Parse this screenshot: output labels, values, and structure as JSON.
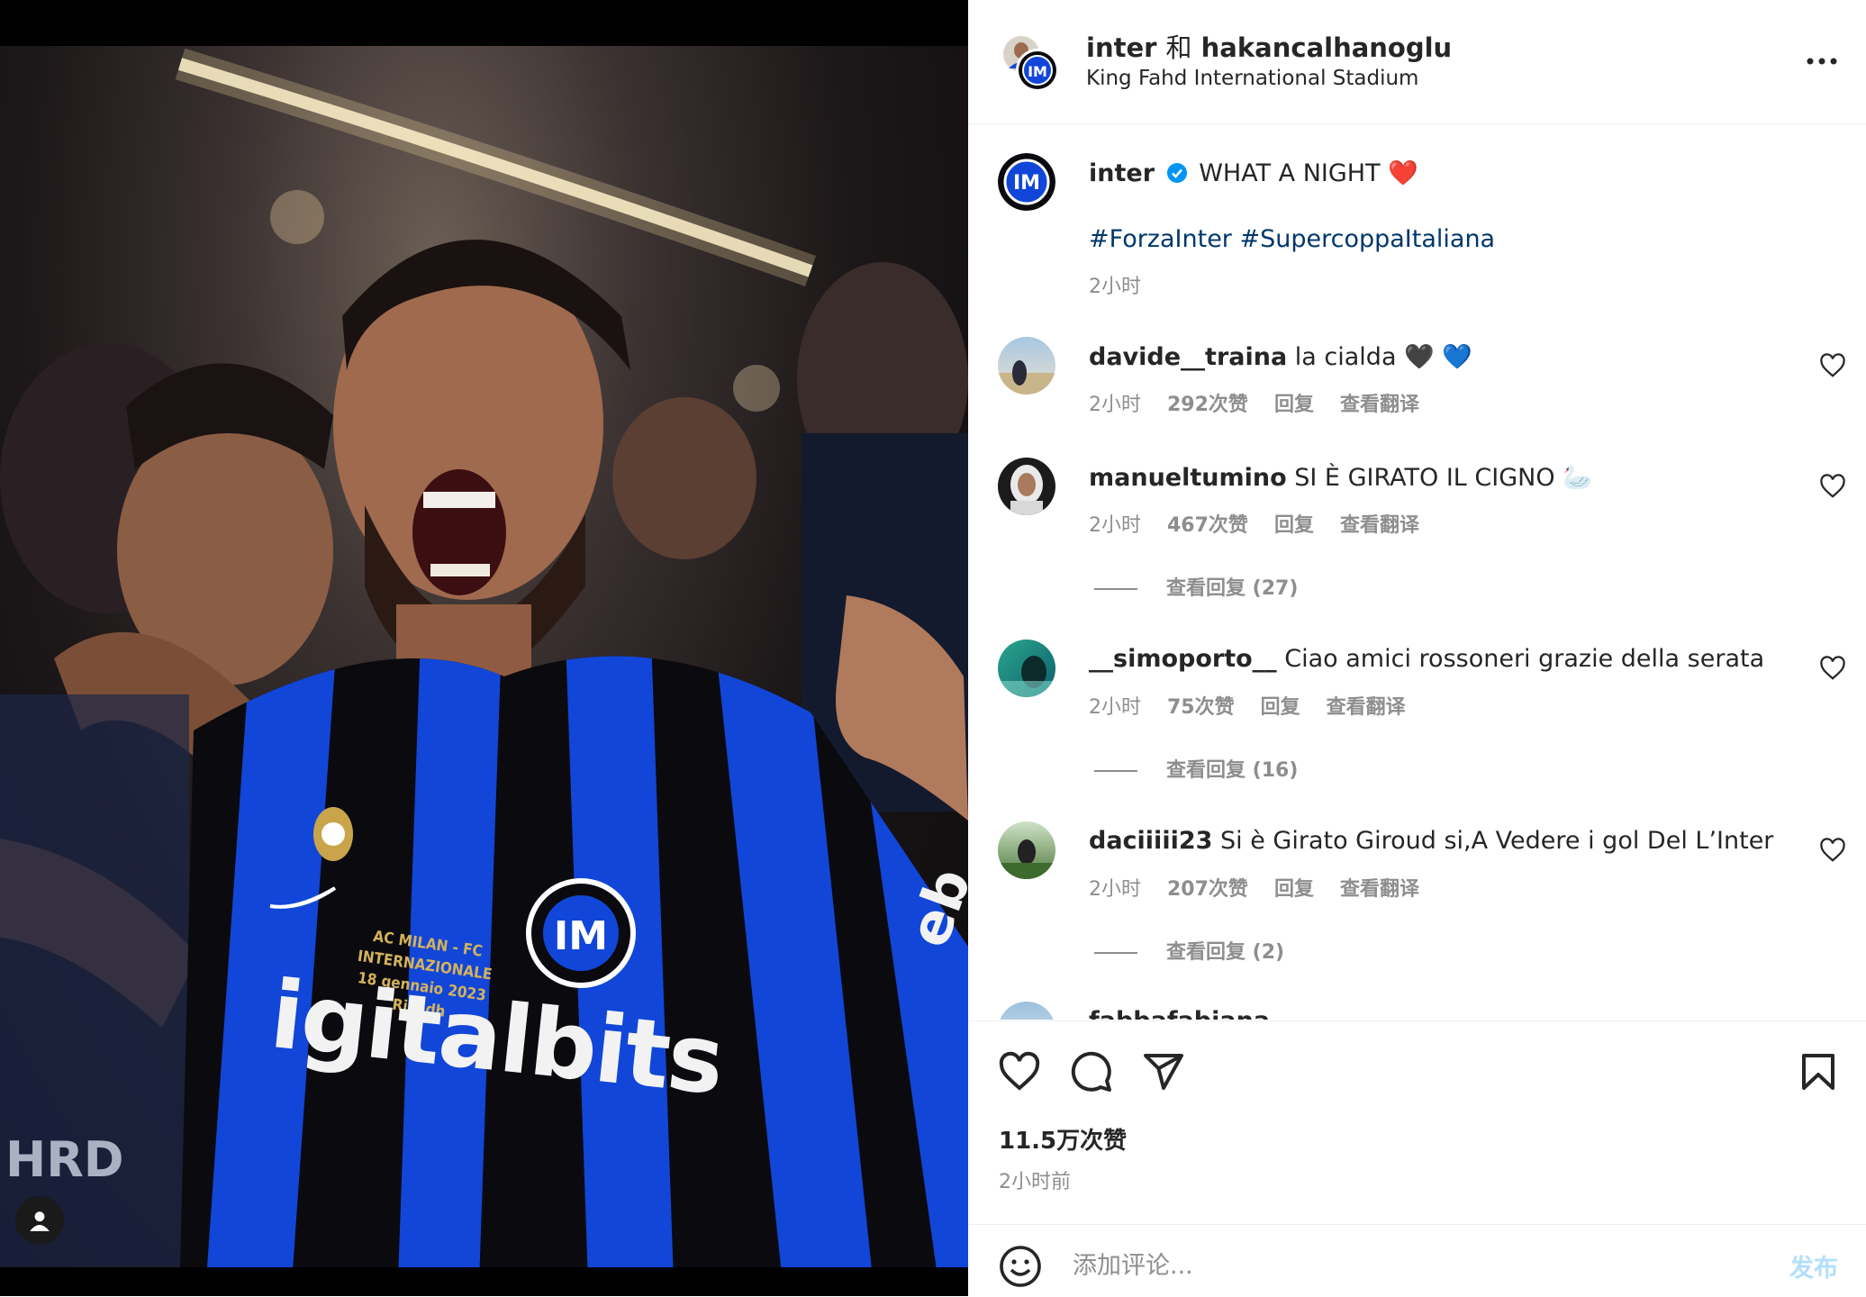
{
  "header": {
    "account_primary": "inter",
    "conjunction": "和",
    "account_secondary": "hakancalhanoglu",
    "location": "King Fahd International Stadium",
    "more_icon": "more-horizontal-icon"
  },
  "caption": {
    "username": "inter",
    "verified": true,
    "text": "WHAT A NIGHT",
    "emoji": "❤️",
    "hashtags": "#ForzaInter #SupercoppaItaliana",
    "time": "2小时"
  },
  "comments": [
    {
      "username": "davide__traina",
      "text": "la cialda",
      "emoji": "🖤 💙",
      "time": "2小时",
      "likes": "292次赞",
      "reply": "回复",
      "translate": "查看翻译"
    },
    {
      "username": "manueltumino",
      "text": "SI È GIRATO IL CIGNO",
      "emoji": "🦢",
      "time": "2小时",
      "likes": "467次赞",
      "reply": "回复",
      "translate": "查看翻译",
      "view_replies": "查看回复 (27)"
    },
    {
      "username": "__simoporto__",
      "text": "Ciao amici rossoneri grazie della serata",
      "emoji": "",
      "time": "2小时",
      "likes": "75次赞",
      "reply": "回复",
      "translate": "查看翻译",
      "view_replies": "查看回复 (16)"
    },
    {
      "username": "daciiiii23",
      "text": "Si è Girato Giroud si,A Vedere i gol Del L’Inter",
      "emoji": "",
      "time": "2小时",
      "likes": "207次赞",
      "reply": "回复",
      "translate": "查看翻译",
      "view_replies": "查看回复 (2)"
    },
    {
      "username": "fabbafabiana",
      "text": "",
      "emoji": "",
      "time": "",
      "likes": "",
      "reply": "",
      "translate": ""
    }
  ],
  "actions": {
    "like_icon": "heart-icon",
    "comment_icon": "comment-icon",
    "share_icon": "send-icon",
    "save_icon": "bookmark-icon",
    "likes": "11.5万次赞",
    "posted": "2小时前"
  },
  "add_comment": {
    "placeholder": "添加评论...",
    "post_label": "发布",
    "emoji_icon": "smiley-icon"
  },
  "photo": {
    "jersey_text": "igitalbits",
    "jersey_patch_lines": [
      "AC MILAN - FC INTERNAZIONALE",
      "18 gennaio 2023",
      "Riyadh"
    ],
    "sleeve_text": "eb",
    "back_text": "HRD",
    "user_tag_icon": "user-tag-icon"
  },
  "colors": {
    "inter_blue": "#0b4fd6",
    "link_blue": "#00376b",
    "verified_blue": "#0095f6",
    "muted": "#8e8e8e",
    "post_disabled": "#b2dffc"
  }
}
